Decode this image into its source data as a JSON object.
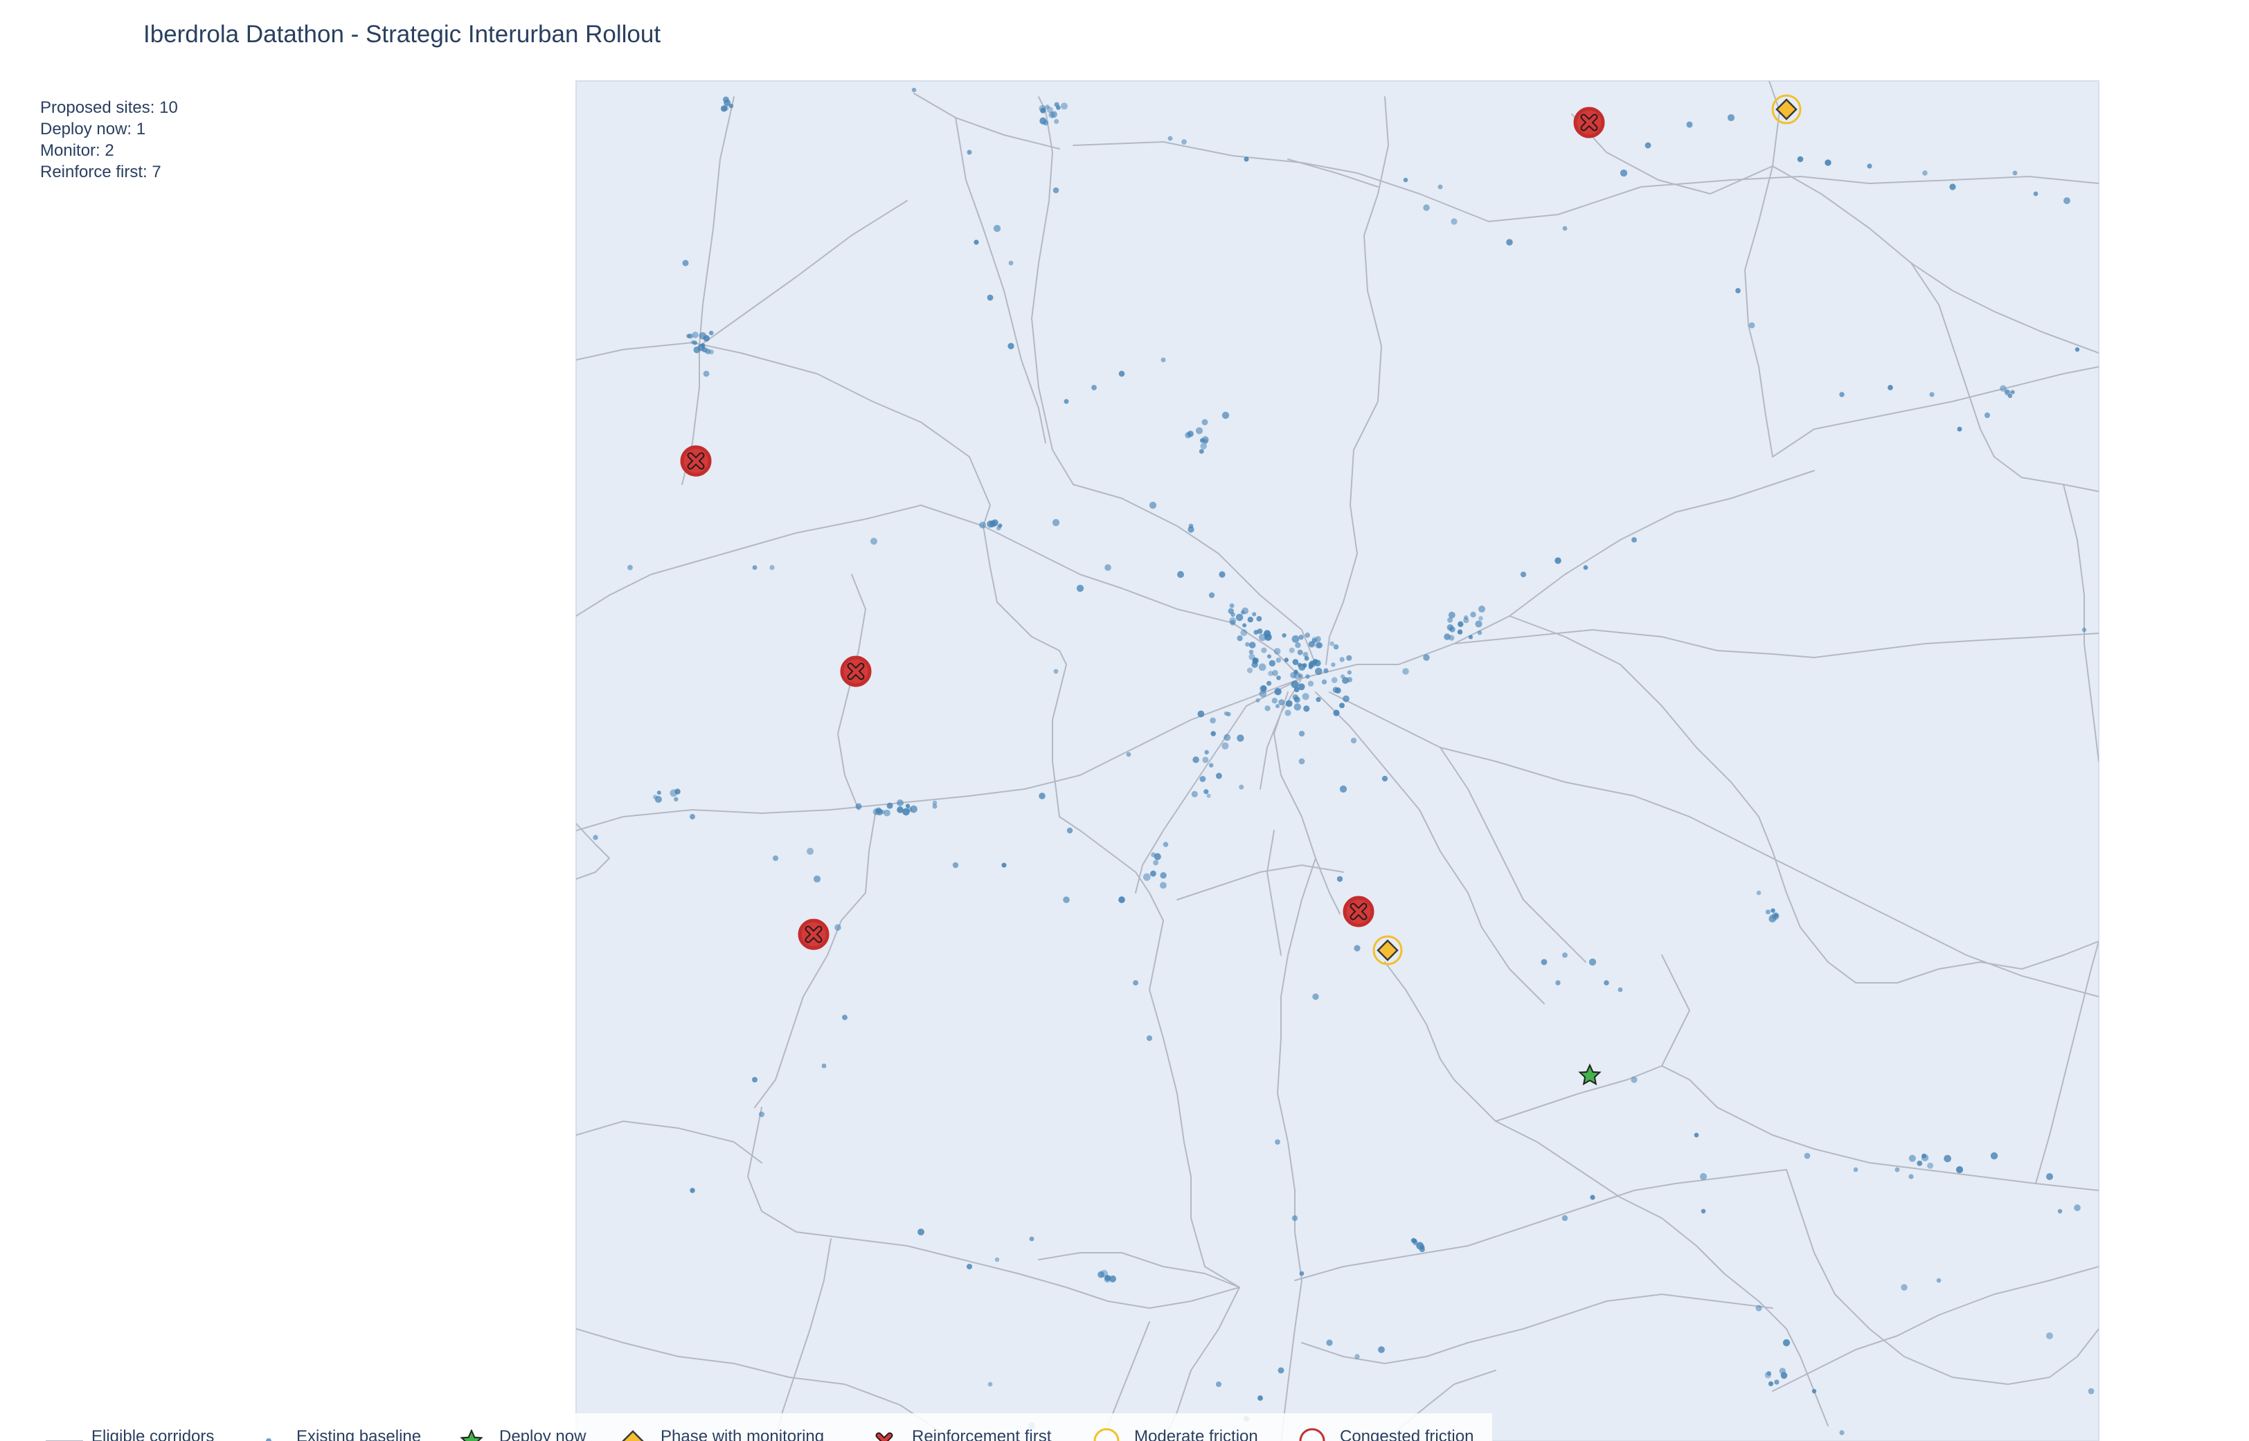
{
  "title": "Iberdrola Datathon - Strategic Interurban Rollout",
  "summary": {
    "proposed": "Proposed sites: 10",
    "deploy": "Deploy now: 1",
    "monitor": "Monitor: 2",
    "reinforce": "Reinforce first: 7"
  },
  "legend": {
    "corridors": "Eligible corridors",
    "baseline": "Existing baseline",
    "deploy": "Deploy now",
    "phase": "Phase with monitoring",
    "reinforce": "Reinforcement first",
    "moderate": "Moderate friction",
    "congested": "Congested friction"
  },
  "colors": {
    "map_background": "#e5ecf6",
    "corridor": "#b4b8c4",
    "baseline": "#4682b4",
    "deploy": "#44b34a",
    "phase": "#f5bd32",
    "reinforce": "#d33a3a",
    "moderate_ring": "#f2c029",
    "congested_ring": "#c42d2d",
    "text": "#2a3f5f"
  }
}
